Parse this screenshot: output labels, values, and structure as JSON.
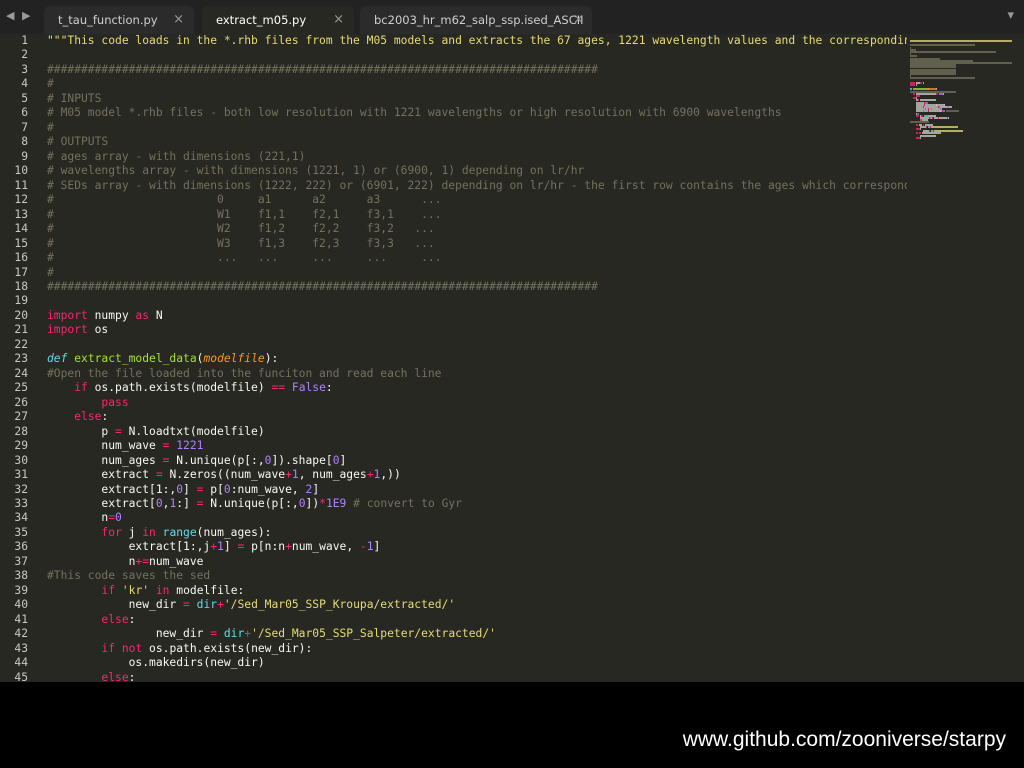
{
  "tabbar": {
    "nav_arrows": "◀ ▶",
    "menu_icon": "chevron-down-icon",
    "tabs": [
      {
        "label": "t_tau_function.py",
        "active": false
      },
      {
        "label": "extract_m05.py",
        "active": true
      },
      {
        "label": "bc2003_hr_m62_salp_ssp.ised_ASCII",
        "active": false
      }
    ],
    "close_glyph": "×"
  },
  "editor": {
    "line_numbers": [
      "1",
      "2",
      "3",
      "4",
      "5",
      "6",
      "7",
      "8",
      "9",
      "10",
      "11",
      "12",
      "13",
      "14",
      "15",
      "16",
      "17",
      "18",
      "19",
      "20",
      "21",
      "22",
      "23",
      "24",
      "25",
      "26",
      "27",
      "28",
      "29",
      "30",
      "31",
      "32",
      "33",
      "34",
      "35",
      "36",
      "37",
      "38",
      "39",
      "40",
      "41",
      "42",
      "43",
      "44",
      "45"
    ],
    "lines": [
      [
        [
          "str",
          "\"\"\"This code loads in the *.rhb files from the M05 models and extracts the 67 ages, 1221 wavelength values and the corresponding"
        ]
      ],
      [
        [
          "tx",
          ""
        ]
      ],
      [
        [
          "com",
          "#################################################################################"
        ]
      ],
      [
        [
          "com",
          "#"
        ]
      ],
      [
        [
          "com",
          "# INPUTS"
        ]
      ],
      [
        [
          "com",
          "# M05 model *.rhb files - both low resolution with 1221 wavelengths or high resolution with 6900 wavelengths"
        ]
      ],
      [
        [
          "com",
          "#"
        ]
      ],
      [
        [
          "com",
          "# OUTPUTS"
        ]
      ],
      [
        [
          "com",
          "# ages array - with dimensions (221,1)"
        ]
      ],
      [
        [
          "com",
          "# wavelengths array - with dimensions (1221, 1) or (6900, 1) depending on lr/hr"
        ]
      ],
      [
        [
          "com",
          "# SEDs array - with dimensions (1222, 222) or (6901, 222) depending on lr/hr - the first row contains the ages which correspond"
        ]
      ],
      [
        [
          "com",
          "#                        0     a1      a2      a3      ..."
        ]
      ],
      [
        [
          "com",
          "#                        W1    f1,1    f2,1    f3,1    ..."
        ]
      ],
      [
        [
          "com",
          "#                        W2    f1,2    f2,2    f3,2   ..."
        ]
      ],
      [
        [
          "com",
          "#                        W3    f1,3    f2,3    f3,3   ..."
        ]
      ],
      [
        [
          "com",
          "#                        ...   ...     ...     ...     ..."
        ]
      ],
      [
        [
          "com",
          "#"
        ]
      ],
      [
        [
          "com",
          "#################################################################################"
        ]
      ],
      [
        [
          "tx",
          ""
        ]
      ],
      [
        [
          "kw",
          "import"
        ],
        [
          "tx",
          " numpy "
        ],
        [
          "kw",
          "as"
        ],
        [
          "tx",
          " N"
        ]
      ],
      [
        [
          "kw",
          "import"
        ],
        [
          "tx",
          " os"
        ]
      ],
      [
        [
          "tx",
          ""
        ]
      ],
      [
        [
          "def",
          "def"
        ],
        [
          "tx",
          " "
        ],
        [
          "fn",
          "extract_model_data"
        ],
        [
          "tx",
          "("
        ],
        [
          "arg",
          "modelfile"
        ],
        [
          "tx",
          "):"
        ]
      ],
      [
        [
          "com",
          "#Open the file loaded into the funciton and read each line"
        ]
      ],
      [
        [
          "tx",
          "    "
        ],
        [
          "kw",
          "if"
        ],
        [
          "tx",
          " os.path.exists(modelfile) "
        ],
        [
          "op",
          "=="
        ],
        [
          "tx",
          " "
        ],
        [
          "num",
          "False"
        ],
        [
          "tx",
          ":"
        ]
      ],
      [
        [
          "tx",
          "        "
        ],
        [
          "kw",
          "pass"
        ]
      ],
      [
        [
          "tx",
          "    "
        ],
        [
          "kw",
          "else"
        ],
        [
          "tx",
          ":"
        ]
      ],
      [
        [
          "tx",
          "        p "
        ],
        [
          "op",
          "="
        ],
        [
          "tx",
          " N.loadtxt(modelfile)"
        ]
      ],
      [
        [
          "tx",
          "        num_wave "
        ],
        [
          "op",
          "="
        ],
        [
          "tx",
          " "
        ],
        [
          "num",
          "1221"
        ]
      ],
      [
        [
          "tx",
          "        num_ages "
        ],
        [
          "op",
          "="
        ],
        [
          "tx",
          " N.unique(p[:,"
        ],
        [
          "num",
          "0"
        ],
        [
          "tx",
          "]).shape["
        ],
        [
          "num",
          "0"
        ],
        [
          "tx",
          "]"
        ]
      ],
      [
        [
          "tx",
          "        extract "
        ],
        [
          "op",
          "="
        ],
        [
          "tx",
          " N.zeros((num_wave"
        ],
        [
          "op",
          "+"
        ],
        [
          "num",
          "1"
        ],
        [
          "tx",
          ", num_ages"
        ],
        [
          "op",
          "+"
        ],
        [
          "num",
          "1"
        ],
        [
          "tx",
          ",))"
        ]
      ],
      [
        [
          "tx",
          "        extract[1:,"
        ],
        [
          "num",
          "0"
        ],
        [
          "tx",
          "] "
        ],
        [
          "op",
          "="
        ],
        [
          "tx",
          " p["
        ],
        [
          "num",
          "0"
        ],
        [
          "tx",
          ":num_wave, "
        ],
        [
          "num",
          "2"
        ],
        [
          "tx",
          "]"
        ]
      ],
      [
        [
          "tx",
          "        extract["
        ],
        [
          "num",
          "0"
        ],
        [
          "tx",
          ","
        ],
        [
          "num",
          "1"
        ],
        [
          "tx",
          ":] "
        ],
        [
          "op",
          "="
        ],
        [
          "tx",
          " N.unique(p[:,"
        ],
        [
          "num",
          "0"
        ],
        [
          "tx",
          "])"
        ],
        [
          "op",
          "*"
        ],
        [
          "num",
          "1E9"
        ],
        [
          "tx",
          " "
        ],
        [
          "com",
          "# convert to Gyr"
        ]
      ],
      [
        [
          "tx",
          "        n"
        ],
        [
          "op",
          "="
        ],
        [
          "num",
          "0"
        ]
      ],
      [
        [
          "tx",
          "        "
        ],
        [
          "kw",
          "for"
        ],
        [
          "tx",
          " j "
        ],
        [
          "kw",
          "in"
        ],
        [
          "tx",
          " "
        ],
        [
          "bi",
          "range"
        ],
        [
          "tx",
          "(num_ages):"
        ]
      ],
      [
        [
          "tx",
          "            extract[1:,j"
        ],
        [
          "op",
          "+"
        ],
        [
          "num",
          "1"
        ],
        [
          "tx",
          "] "
        ],
        [
          "op",
          "="
        ],
        [
          "tx",
          " p[n:n"
        ],
        [
          "op",
          "+"
        ],
        [
          "tx",
          "num_wave, "
        ],
        [
          "op",
          "-"
        ],
        [
          "num",
          "1"
        ],
        [
          "tx",
          "]"
        ]
      ],
      [
        [
          "tx",
          "            n"
        ],
        [
          "op",
          "+="
        ],
        [
          "tx",
          "num_wave"
        ]
      ],
      [
        [
          "com",
          "#This code saves the sed"
        ]
      ],
      [
        [
          "tx",
          "        "
        ],
        [
          "kw",
          "if"
        ],
        [
          "tx",
          " "
        ],
        [
          "str",
          "'kr'"
        ],
        [
          "tx",
          " "
        ],
        [
          "kw",
          "in"
        ],
        [
          "tx",
          " modelfile:"
        ]
      ],
      [
        [
          "tx",
          "            new_dir "
        ],
        [
          "op",
          "="
        ],
        [
          "tx",
          " "
        ],
        [
          "bi",
          "dir"
        ],
        [
          "op",
          "+"
        ],
        [
          "str",
          "'/Sed_Mar05_SSP_Kroupa/extracted/'"
        ]
      ],
      [
        [
          "tx",
          "        "
        ],
        [
          "kw",
          "else"
        ],
        [
          "tx",
          ":"
        ]
      ],
      [
        [
          "tx",
          "                new_dir "
        ],
        [
          "op",
          "="
        ],
        [
          "tx",
          " "
        ],
        [
          "bi",
          "dir"
        ],
        [
          "op",
          "+"
        ],
        [
          "str",
          "'/Sed_Mar05_SSP_Salpeter/extracted/'"
        ]
      ],
      [
        [
          "tx",
          "        "
        ],
        [
          "kw",
          "if"
        ],
        [
          "tx",
          " "
        ],
        [
          "kw",
          "not"
        ],
        [
          "tx",
          " os.path.exists(new_dir):"
        ]
      ],
      [
        [
          "tx",
          "            os.makedirs(new_dir)"
        ]
      ],
      [
        [
          "tx",
          "        "
        ],
        [
          "kw",
          "else"
        ],
        [
          "tx",
          ":"
        ]
      ]
    ]
  },
  "footer": {
    "url": "www.github.com/zooniverse/starpy"
  },
  "colors": {
    "editor_bg": "#272822",
    "tab_bar_bg": "#222222",
    "comment": "#75715e",
    "string": "#e6db74",
    "keyword": "#f92672",
    "number": "#ae81ff",
    "function": "#a6e22e",
    "builtin": "#66d9ef",
    "argument": "#fd971f",
    "text": "#f8f8f2"
  }
}
